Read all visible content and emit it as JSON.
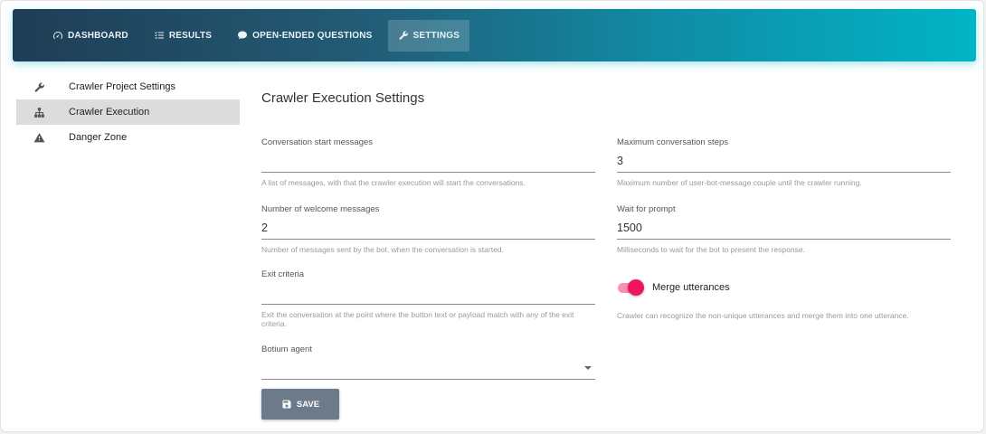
{
  "nav": {
    "items": [
      {
        "label": "DASHBOARD",
        "icon": "speedometer-icon"
      },
      {
        "label": "RESULTS",
        "icon": "checklist-icon"
      },
      {
        "label": "OPEN-ENDED QUESTIONS",
        "icon": "chat-bubble-icon"
      },
      {
        "label": "SETTINGS",
        "icon": "wrench-icon",
        "active": true
      }
    ]
  },
  "sidebar": {
    "items": [
      {
        "label": "Crawler Project Settings",
        "icon": "wrench-icon"
      },
      {
        "label": "Crawler Execution",
        "icon": "sitemap-icon",
        "active": true
      },
      {
        "label": "Danger Zone",
        "icon": "warning-icon"
      }
    ]
  },
  "main": {
    "title": "Crawler Execution Settings",
    "fields": {
      "conversation_start": {
        "label": "Conversation start messages",
        "value": "",
        "help": "A list of messages, with that the crawler execution will start the conversations."
      },
      "max_steps": {
        "label": "Maximum conversation steps",
        "value": "3",
        "help": "Maximum number of user-bot-message couple until the crawler running."
      },
      "welcome_messages": {
        "label": "Number of welcome messages",
        "value": "2",
        "help": "Number of messages sent by the bot, when the conversation is started."
      },
      "wait_for_prompt": {
        "label": "Wait for prompt",
        "value": "1500",
        "help": "Milliseconds to wait for the bot to present the response."
      },
      "exit_criteria": {
        "label": "Exit criteria",
        "value": "",
        "help": "Exit the conversation at the point where the button text or payload match with any of the exit criteria."
      },
      "botium_agent": {
        "label": "Botium agent",
        "value": ""
      }
    },
    "merge_utterances": {
      "label": "Merge utterances",
      "enabled": true,
      "help": "Crawler can recognize the non-unique utterances and merge them into one utterance."
    },
    "save_label": "SAVE"
  },
  "colors": {
    "accent": "#f0145a",
    "topbar_start": "#1f3d55",
    "topbar_end": "#01b5c6",
    "save_button": "#6c7a89"
  }
}
